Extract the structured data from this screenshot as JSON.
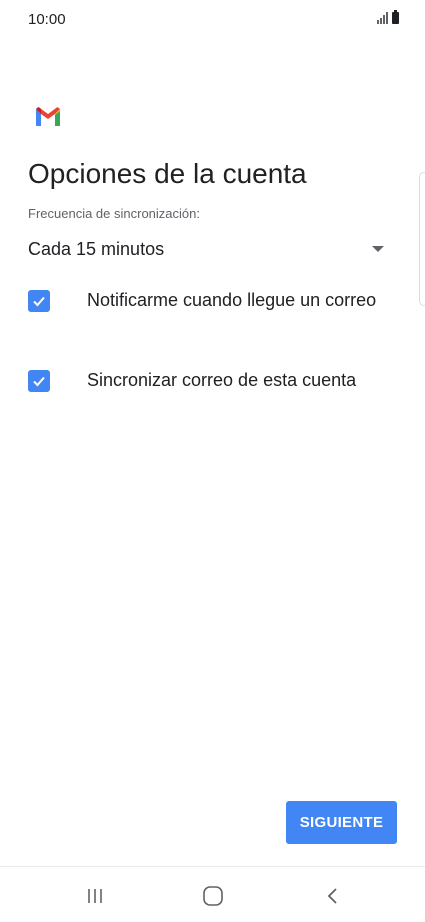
{
  "status_bar": {
    "time": "10:00"
  },
  "app": {
    "logo": "gmail-logo",
    "brand_colors": {
      "blue": "#4285F4",
      "red": "#EA4335",
      "yellow": "#FBBC04",
      "green": "#34A853"
    }
  },
  "page": {
    "title": "Opciones de la cuenta"
  },
  "sync_frequency": {
    "label": "Frecuencia de sincronización:",
    "selected_value": "Cada 15 minutos"
  },
  "options": [
    {
      "label": "Notificarme cuando llegue un correo",
      "checked": true
    },
    {
      "label": "Sincronizar correo de esta cuenta",
      "checked": true
    }
  ],
  "actions": {
    "next_label": "SIGUIENTE"
  },
  "navigation": {
    "recents_icon": "recents-icon",
    "home_icon": "home-icon",
    "back_icon": "back-icon"
  },
  "colors": {
    "accent": "#4285F4",
    "text_primary": "#202124",
    "text_secondary": "#5F6368"
  }
}
